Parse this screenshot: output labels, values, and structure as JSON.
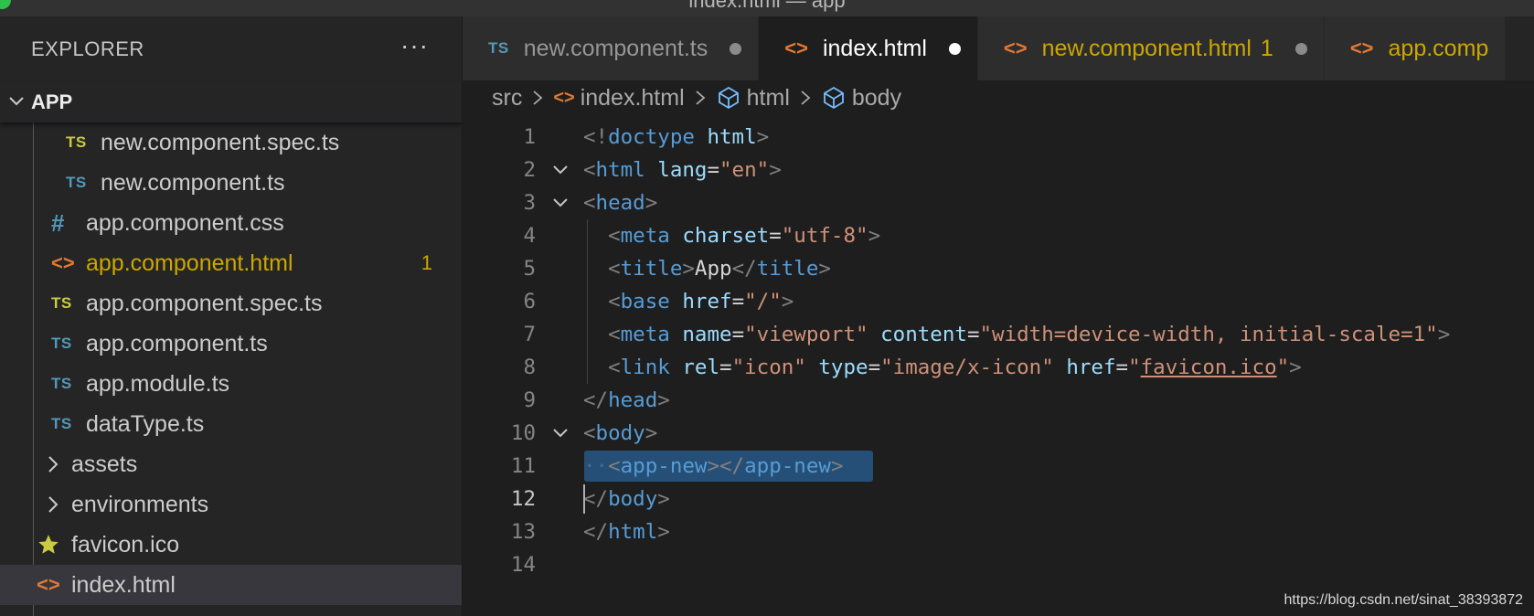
{
  "window": {
    "title": "index.html — app"
  },
  "sidebar": {
    "header": "EXPLORER",
    "more_label": "···",
    "section": "APP",
    "items": [
      {
        "label": "new.component.spec.ts",
        "icon": "TS",
        "kind": "ts-spec-file"
      },
      {
        "label": "new.component.ts",
        "icon": "TS",
        "kind": "ts-file"
      },
      {
        "label": "app.component.css",
        "icon": "#",
        "kind": "css-file"
      },
      {
        "label": "app.component.html",
        "icon": "<>",
        "kind": "html-file",
        "badge": "1",
        "warning": true
      },
      {
        "label": "app.component.spec.ts",
        "icon": "TS",
        "kind": "ts-spec-file"
      },
      {
        "label": "app.component.ts",
        "icon": "TS",
        "kind": "ts-file"
      },
      {
        "label": "app.module.ts",
        "icon": "TS",
        "kind": "ts-file"
      },
      {
        "label": "dataType.ts",
        "icon": "TS",
        "kind": "ts-file"
      },
      {
        "label": "assets",
        "kind": "folder"
      },
      {
        "label": "environments",
        "kind": "folder"
      },
      {
        "label": "favicon.ico",
        "kind": "favicon-file"
      },
      {
        "label": "index.html",
        "icon": "<>",
        "kind": "html-file",
        "selected": true
      }
    ]
  },
  "tabs": [
    {
      "label": "new.component.ts",
      "icon": "TS",
      "dirty": true
    },
    {
      "label": "index.html",
      "icon": "<>",
      "dirty": true,
      "active": true
    },
    {
      "label": "new.component.html",
      "icon": "<>",
      "badge": "1",
      "dirty": true,
      "warning": true
    },
    {
      "label": "app.comp",
      "icon": "<>",
      "warning": true
    }
  ],
  "breadcrumbs": {
    "folder": "src",
    "file": "index.html",
    "sym1": "html",
    "sym2": "body"
  },
  "code": {
    "line_numbers": [
      "1",
      "2",
      "3",
      "4",
      "5",
      "6",
      "7",
      "8",
      "9",
      "10",
      "11",
      "12",
      "13",
      "14"
    ],
    "current_line": "12",
    "lines": [
      [
        [
          "punc",
          "<!"
        ],
        [
          "tag",
          "doctype"
        ],
        [
          "text",
          " "
        ],
        [
          "attr",
          "html"
        ],
        [
          "punc",
          ">"
        ]
      ],
      [
        [
          "punc",
          "<"
        ],
        [
          "tag",
          "html"
        ],
        [
          "text",
          " "
        ],
        [
          "attr",
          "lang"
        ],
        [
          "text",
          "="
        ],
        [
          "str",
          "\"en\""
        ],
        [
          "punc",
          ">"
        ]
      ],
      [
        [
          "punc",
          "<"
        ],
        [
          "tag",
          "head"
        ],
        [
          "punc",
          ">"
        ]
      ],
      [
        [
          "text",
          "  "
        ],
        [
          "punc",
          "<"
        ],
        [
          "tag",
          "meta"
        ],
        [
          "text",
          " "
        ],
        [
          "attr",
          "charset"
        ],
        [
          "text",
          "="
        ],
        [
          "str",
          "\"utf-8\""
        ],
        [
          "punc",
          ">"
        ]
      ],
      [
        [
          "text",
          "  "
        ],
        [
          "punc",
          "<"
        ],
        [
          "tag",
          "title"
        ],
        [
          "punc",
          ">"
        ],
        [
          "text",
          "App"
        ],
        [
          "punc",
          "</"
        ],
        [
          "tag",
          "title"
        ],
        [
          "punc",
          ">"
        ]
      ],
      [
        [
          "text",
          "  "
        ],
        [
          "punc",
          "<"
        ],
        [
          "tag",
          "base"
        ],
        [
          "text",
          " "
        ],
        [
          "attr",
          "href"
        ],
        [
          "text",
          "="
        ],
        [
          "str",
          "\"/\""
        ],
        [
          "punc",
          ">"
        ]
      ],
      [
        [
          "text",
          "  "
        ],
        [
          "punc",
          "<"
        ],
        [
          "tag",
          "meta"
        ],
        [
          "text",
          " "
        ],
        [
          "attr",
          "name"
        ],
        [
          "text",
          "="
        ],
        [
          "str",
          "\"viewport\""
        ],
        [
          "text",
          " "
        ],
        [
          "attr",
          "content"
        ],
        [
          "text",
          "="
        ],
        [
          "str",
          "\"width=device-width, initial-scale=1\""
        ],
        [
          "punc",
          ">"
        ]
      ],
      [
        [
          "text",
          "  "
        ],
        [
          "punc",
          "<"
        ],
        [
          "tag",
          "link"
        ],
        [
          "text",
          " "
        ],
        [
          "attr",
          "rel"
        ],
        [
          "text",
          "="
        ],
        [
          "str",
          "\"icon\""
        ],
        [
          "text",
          " "
        ],
        [
          "attr",
          "type"
        ],
        [
          "text",
          "="
        ],
        [
          "str",
          "\"image/x-icon\""
        ],
        [
          "text",
          " "
        ],
        [
          "attr",
          "href"
        ],
        [
          "text",
          "="
        ],
        [
          "str",
          "\""
        ],
        [
          "link",
          "favicon.ico"
        ],
        [
          "str",
          "\""
        ],
        [
          "punc",
          ">"
        ]
      ],
      [
        [
          "punc",
          "</"
        ],
        [
          "tag",
          "head"
        ],
        [
          "punc",
          ">"
        ]
      ],
      [
        [
          "punc",
          "<"
        ],
        [
          "tag",
          "body"
        ],
        [
          "punc",
          ">"
        ]
      ],
      [
        [
          "ws",
          "··"
        ],
        [
          "punc",
          "<"
        ],
        [
          "tag",
          "app-new"
        ],
        [
          "punc",
          "></"
        ],
        [
          "tag",
          "app-new"
        ],
        [
          "punc",
          ">"
        ]
      ],
      [
        [
          "punc",
          "</"
        ],
        [
          "tag",
          "body"
        ],
        [
          "punc",
          ">"
        ]
      ],
      [
        [
          "punc",
          "</"
        ],
        [
          "tag",
          "html"
        ],
        [
          "punc",
          ">"
        ]
      ],
      []
    ]
  },
  "watermark": "https://blog.csdn.net/sinat_38393872",
  "colors": {
    "accent_warning": "#cca700",
    "ts_blue": "#519aba",
    "html_orange": "#e37933",
    "selection": "#264f78"
  }
}
